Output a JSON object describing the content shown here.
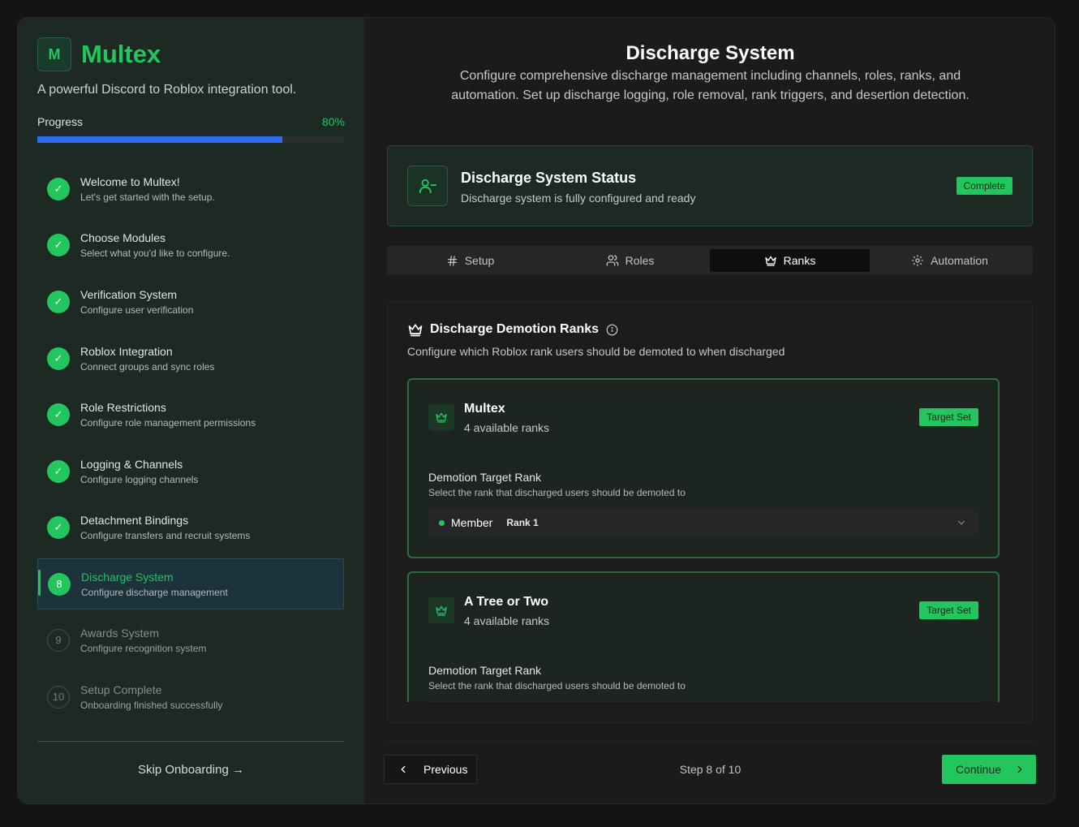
{
  "brand": {
    "logo_letter": "M",
    "name": "Multex",
    "tagline": "A powerful Discord to Roblox integration tool."
  },
  "progress": {
    "label": "Progress",
    "value_text": "80%",
    "fraction": 0.8
  },
  "steps": [
    {
      "marker": "✓",
      "title": "Welcome to Multex!",
      "subtitle": "Let's get started with the setup.",
      "state": "done"
    },
    {
      "marker": "✓",
      "title": "Choose Modules",
      "subtitle": "Select what you'd like to configure.",
      "state": "done"
    },
    {
      "marker": "✓",
      "title": "Verification System",
      "subtitle": "Configure user verification",
      "state": "done"
    },
    {
      "marker": "✓",
      "title": "Roblox Integration",
      "subtitle": "Connect groups and sync roles",
      "state": "done"
    },
    {
      "marker": "✓",
      "title": "Role Restrictions",
      "subtitle": "Configure role management permissions",
      "state": "done"
    },
    {
      "marker": "✓",
      "title": "Logging & Channels",
      "subtitle": "Configure logging channels",
      "state": "done"
    },
    {
      "marker": "✓",
      "title": "Detachment Bindings",
      "subtitle": "Configure transfers and recruit systems",
      "state": "done"
    },
    {
      "marker": "8",
      "title": "Discharge System",
      "subtitle": "Configure discharge management",
      "state": "active"
    },
    {
      "marker": "9",
      "title": "Awards System",
      "subtitle": "Configure recognition system",
      "state": "pending"
    },
    {
      "marker": "10",
      "title": "Setup Complete",
      "subtitle": "Onboarding finished successfully",
      "state": "pending"
    }
  ],
  "skip_label": "Skip Onboarding →",
  "page": {
    "title": "Discharge System",
    "description": "Configure comprehensive discharge management including channels, roles, ranks, and automation. Set up discharge logging, role removal, rank triggers, and desertion detection."
  },
  "status": {
    "title": "Discharge System Status",
    "subtitle": "Discharge system is fully configured and ready",
    "badge": "Complete",
    "icon": "user-minus-icon"
  },
  "tabs": [
    {
      "label": "Setup",
      "icon": "hash-icon"
    },
    {
      "label": "Roles",
      "icon": "users-icon"
    },
    {
      "label": "Ranks",
      "icon": "crown-icon",
      "active": true
    },
    {
      "label": "Automation",
      "icon": "gear-icon"
    }
  ],
  "panel": {
    "title": "Discharge Demotion Ranks",
    "subtitle": "Configure which Roblox rank users should be demoted to when discharged",
    "groups": [
      {
        "name": "Multex",
        "count": "4 available ranks",
        "badge": "Target Set",
        "field_label": "Demotion Target Rank",
        "field_help": "Select the rank that discharged users should be demoted to",
        "selected_value": "Member",
        "selected_rank": "Rank 1"
      },
      {
        "name": "A Tree or Two",
        "count": "4 available ranks",
        "badge": "Target Set",
        "field_label": "Demotion Target Rank",
        "field_help": "Select the rank that discharged users should be demoted to",
        "selected_value": "",
        "selected_rank": ""
      }
    ]
  },
  "footer": {
    "prev_label": "Previous",
    "step_text": "Step 8 of 10",
    "next_label": "Continue"
  },
  "colors": {
    "accent": "#22c55e",
    "progress": "#2d6cf0",
    "sidebar_bg": "#1d2a24",
    "main_bg": "#1b1b1b"
  }
}
